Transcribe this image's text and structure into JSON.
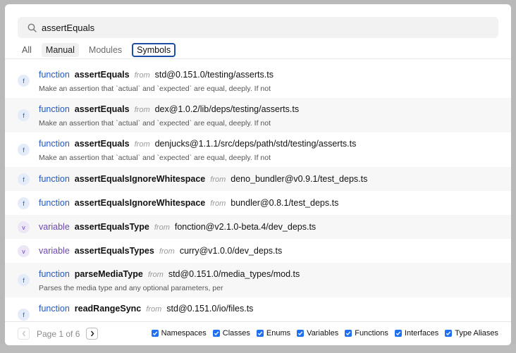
{
  "search": {
    "value": "assertEquals"
  },
  "tabs": [
    {
      "label": "All"
    },
    {
      "label": "Manual"
    },
    {
      "label": "Modules"
    },
    {
      "label": "Symbols"
    }
  ],
  "results": [
    {
      "badge": "f",
      "kind": "function",
      "name": "assertEquals",
      "from": "from",
      "path": "std@0.151.0/testing/asserts.ts",
      "desc": "Make an assertion that `actual` and `expected` are equal, deeply. If not"
    },
    {
      "badge": "f",
      "kind": "function",
      "name": "assertEquals",
      "from": "from",
      "path": "dex@1.0.2/lib/deps/testing/asserts.ts",
      "desc": "Make an assertion that `actual` and `expected` are equal, deeply. If not"
    },
    {
      "badge": "f",
      "kind": "function",
      "name": "assertEquals",
      "from": "from",
      "path": "denjucks@1.1.1/src/deps/path/std/testing/asserts.ts",
      "desc": "Make an assertion that `actual` and `expected` are equal, deeply. If not"
    },
    {
      "badge": "f",
      "kind": "function",
      "name": "assertEqualsIgnoreWhitespace",
      "from": "from",
      "path": "deno_bundler@v0.9.1/test_deps.ts"
    },
    {
      "badge": "f",
      "kind": "function",
      "name": "assertEqualsIgnoreWhitespace",
      "from": "from",
      "path": "bundler@0.8.1/test_deps.ts"
    },
    {
      "badge": "v",
      "kind": "variable",
      "name": "assertEqualsType",
      "from": "from",
      "path": "fonction@v2.1.0-beta.4/dev_deps.ts"
    },
    {
      "badge": "v",
      "kind": "variable",
      "name": "assertEqualsTypes",
      "from": "from",
      "path": "curry@v1.0.0/dev_deps.ts"
    },
    {
      "badge": "f",
      "kind": "function",
      "name": "parseMediaType",
      "from": "from",
      "path": "std@0.151.0/media_types/mod.ts",
      "desc": "Parses the media type and any optional parameters, per"
    },
    {
      "badge": "f",
      "kind": "function",
      "name": "readRangeSync",
      "from": "from",
      "path": "std@0.151.0/io/files.ts"
    }
  ],
  "pagination": {
    "label": "Page 1 of 6"
  },
  "filters": [
    {
      "label": "Namespaces"
    },
    {
      "label": "Classes"
    },
    {
      "label": "Enums"
    },
    {
      "label": "Variables"
    },
    {
      "label": "Functions"
    },
    {
      "label": "Interfaces"
    },
    {
      "label": "Type Aliases"
    }
  ],
  "icons": {
    "search": "search-icon",
    "prev": "chevron-left-icon",
    "next": "chevron-right-icon",
    "check": "check-icon"
  },
  "colors": {
    "accent": "#1e4da8",
    "function": "#2158c2",
    "variable": "#6a47b0",
    "checkbox": "#1e6ff1"
  }
}
